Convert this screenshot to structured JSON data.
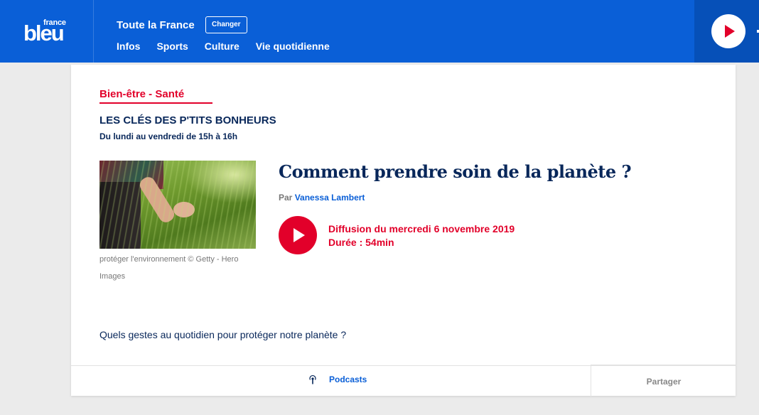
{
  "header": {
    "logo_small": "france",
    "logo_big": "bleu",
    "region": "Toute la France",
    "change_label": "Changer",
    "nav": [
      "Infos",
      "Sports",
      "Culture",
      "Vie quotidienne"
    ],
    "brand_color": "#0a5fd7",
    "accent_color": "#e2002a",
    "player_icon": "play-icon"
  },
  "show": {
    "category": "Bien-être - Santé",
    "title": "LES CLÉS DES P'TITS BONHEURS",
    "schedule": "Du lundi au vendredi de 15h à 16h"
  },
  "article": {
    "image_caption": "protéger l'environnement © Getty - Hero Images",
    "title": "Comment prendre soin de la planète ?",
    "byline_prefix": "Par",
    "author": "Vanessa Lambert",
    "diffusion": "Diffusion du mercredi 6 novembre 2019",
    "duration": "Durée : 54min",
    "summary": "Quels gestes au quotidien pour protéger notre planète ?"
  },
  "footer": {
    "podcasts_label": "Podcasts",
    "podcast_icon": "podcast-icon",
    "share_label": "Partager"
  }
}
